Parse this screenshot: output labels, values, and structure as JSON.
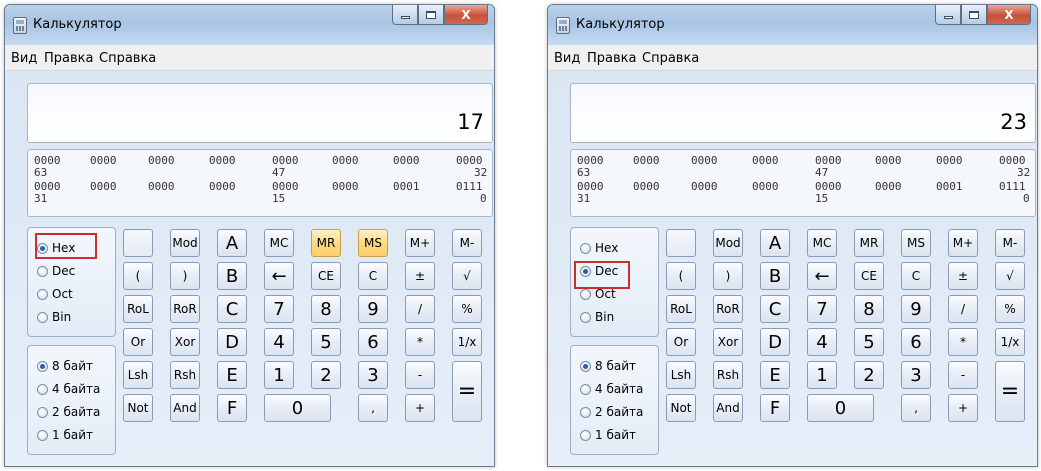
{
  "windows": [
    {
      "title": "Калькулятор",
      "close_label": "X",
      "menu": [
        "Вид",
        "Правка",
        "Справка"
      ],
      "display_value": "17",
      "bits": {
        "row1": [
          "0000",
          "0000",
          "0000",
          "0000",
          "0000",
          "0000",
          "0000",
          "0000"
        ],
        "row1_pos": [
          "63",
          "47",
          "32"
        ],
        "row2": [
          "0000",
          "0000",
          "0000",
          "0000",
          "0000",
          "0000",
          "0001",
          "0111"
        ],
        "row2_pos": [
          "31",
          "15",
          "0"
        ]
      },
      "base_modes": [
        "Hex",
        "Dec",
        "Oct",
        "Bin"
      ],
      "selected_base": "Hex",
      "word_sizes": [
        "8 байт",
        "4 байта",
        "2 байта",
        "1 байт"
      ],
      "selected_word_size": "8 байт",
      "highlighted_buttons": [
        "MR",
        "MS"
      ]
    },
    {
      "title": "Калькулятор",
      "close_label": "X",
      "menu": [
        "Вид",
        "Правка",
        "Справка"
      ],
      "display_value": "23",
      "bits": {
        "row1": [
          "0000",
          "0000",
          "0000",
          "0000",
          "0000",
          "0000",
          "0000",
          "0000"
        ],
        "row1_pos": [
          "63",
          "47",
          "32"
        ],
        "row2": [
          "0000",
          "0000",
          "0000",
          "0000",
          "0000",
          "0000",
          "0001",
          "0111"
        ],
        "row2_pos": [
          "31",
          "15",
          "0"
        ]
      },
      "base_modes": [
        "Hex",
        "Dec",
        "Oct",
        "Bin"
      ],
      "selected_base": "Dec",
      "word_sizes": [
        "8 байт",
        "4 байта",
        "2 байта",
        "1 байт"
      ],
      "selected_word_size": "8 байт",
      "highlighted_buttons": []
    }
  ],
  "keypad": [
    [
      "",
      "Mod",
      "A",
      "MC",
      "MR",
      "MS",
      "M+",
      "M-"
    ],
    [
      "(",
      ")",
      "B",
      "←",
      "CE",
      "C",
      "±",
      "√"
    ],
    [
      "RoL",
      "RoR",
      "C",
      "7",
      "8",
      "9",
      "/",
      "%"
    ],
    [
      "Or",
      "Xor",
      "D",
      "4",
      "5",
      "6",
      "*",
      "1/x"
    ],
    [
      "Lsh",
      "Rsh",
      "E",
      "1",
      "2",
      "3",
      "-",
      "="
    ],
    [
      "Not",
      "And",
      "F",
      "0",
      "",
      ",",
      "+",
      ""
    ]
  ],
  "colors": {
    "highlight_border": "#c8302f",
    "warm_button": "#ffd780"
  }
}
